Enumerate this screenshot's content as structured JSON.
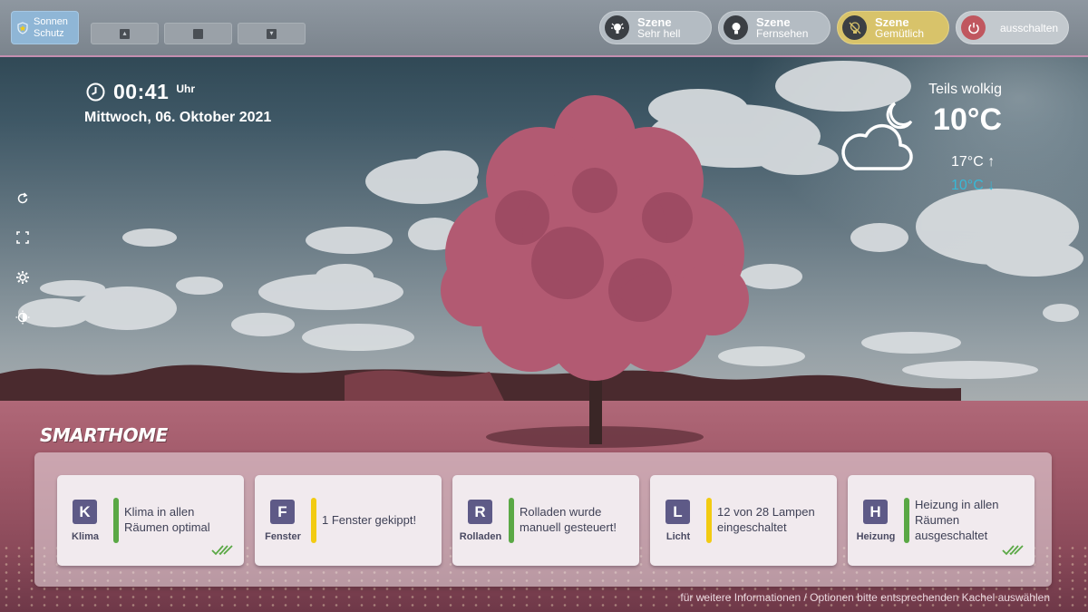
{
  "topbar": {
    "sun_button": {
      "label": "Sonnen Schutz",
      "icon": "sun-shield-icon"
    },
    "shutter_buttons": [
      {
        "icon": "arrow-up-icon"
      },
      {
        "icon": "stop-icon"
      },
      {
        "icon": "arrow-down-icon"
      }
    ],
    "scenes": [
      {
        "title": "Szene",
        "subtitle": "Sehr hell",
        "icon": "bulb-bright-icon",
        "active": false
      },
      {
        "title": "Szene",
        "subtitle": "Fernsehen",
        "icon": "bulb-icon",
        "active": false
      },
      {
        "title": "Szene",
        "subtitle": "Gemütlich",
        "icon": "bulb-off-icon",
        "active": true
      }
    ],
    "off_button": {
      "label": "ausschalten",
      "icon": "power-icon"
    },
    "colors": {
      "active_scene": "#d8c36a",
      "off_icon_bg": "#c0575f",
      "sun_button": "#8fb6d6"
    }
  },
  "clock": {
    "time": "00:41",
    "unit": "Uhr",
    "date": "Mittwoch, 06. Oktober 2021"
  },
  "side_icons": [
    "refresh-icon",
    "fullscreen-icon",
    "settings-icon",
    "brightness-icon"
  ],
  "weather": {
    "condition": "Teils wolkig",
    "temperature": "10°C",
    "max": "17°C ↑",
    "min": "10°C ↓",
    "icon": "cloud-moon-icon",
    "min_color": "#38b8d6"
  },
  "smarthome": {
    "title": "SMARTHOME",
    "tiles": [
      {
        "letter": "K",
        "category": "Klima",
        "message": "Klima in allen Räumen optimal",
        "status_color": "#5aa845",
        "check": true
      },
      {
        "letter": "F",
        "category": "Fenster",
        "message": "1 Fenster gekippt!",
        "status_color": "#f2cb12",
        "check": false
      },
      {
        "letter": "R",
        "category": "Rolladen",
        "message": "Rolladen wurde manuell gesteuert!",
        "status_color": "#5aa845",
        "check": false
      },
      {
        "letter": "L",
        "category": "Licht",
        "message": "12 von 28 Lampen eingeschaltet",
        "status_color": "#f2cb12",
        "check": false
      },
      {
        "letter": "H",
        "category": "Heizung",
        "message": "Heizung in allen Räumen ausgeschaltet",
        "status_color": "#5aa845",
        "check": true
      }
    ],
    "footnote": "für weitere Informationen / Optionen bitte entsprechenden Kachel auswählen"
  }
}
